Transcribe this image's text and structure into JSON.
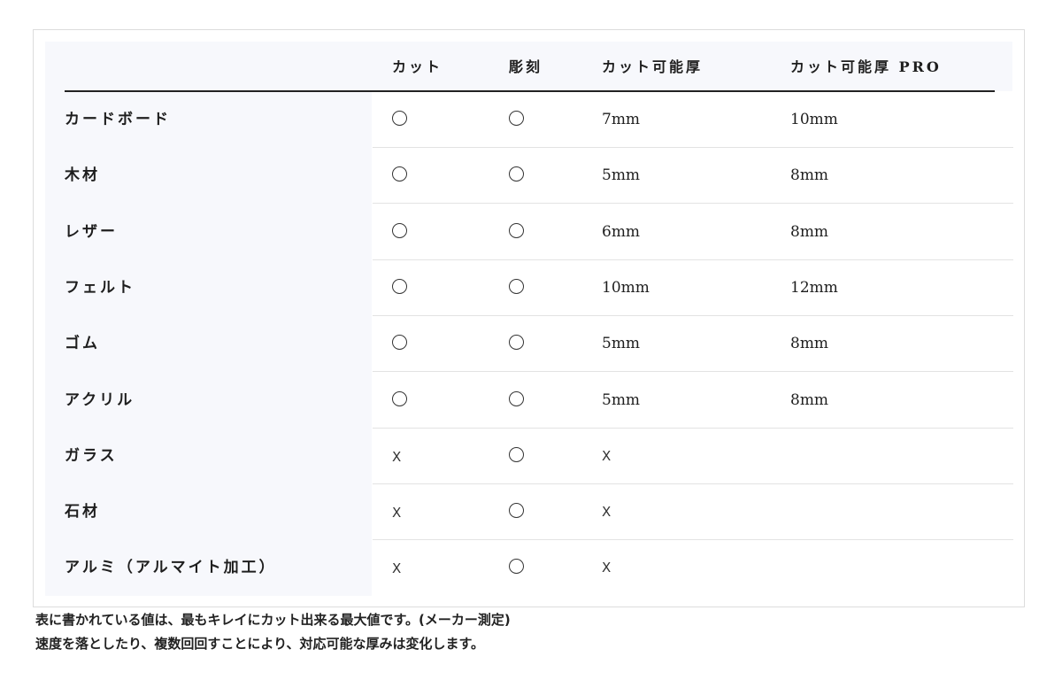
{
  "table": {
    "headers": {
      "material": "",
      "cut": "カット",
      "engrave": "彫刻",
      "thickness": "カット可能厚",
      "thickness_pro": "カット可能厚 PRO"
    },
    "rows": [
      {
        "material": "カードボード",
        "cut": "circle",
        "engrave": "circle",
        "thickness": "7mm",
        "thickness_pro": "10mm"
      },
      {
        "material": "木材",
        "cut": "circle",
        "engrave": "circle",
        "thickness": "5mm",
        "thickness_pro": "8mm"
      },
      {
        "material": "レザー",
        "cut": "circle",
        "engrave": "circle",
        "thickness": "6mm",
        "thickness_pro": "8mm"
      },
      {
        "material": "フェルト",
        "cut": "circle",
        "engrave": "circle",
        "thickness": "10mm",
        "thickness_pro": "12mm"
      },
      {
        "material": "ゴム",
        "cut": "circle",
        "engrave": "circle",
        "thickness": "5mm",
        "thickness_pro": "8mm"
      },
      {
        "material": "アクリル",
        "cut": "circle",
        "engrave": "circle",
        "thickness": "5mm",
        "thickness_pro": "8mm"
      },
      {
        "material": "ガラス",
        "cut": "X",
        "engrave": "circle",
        "thickness": "X",
        "thickness_pro": ""
      },
      {
        "material": "石材",
        "cut": "X",
        "engrave": "circle",
        "thickness": "X",
        "thickness_pro": ""
      },
      {
        "material": "アルミ（アルマイト加工）",
        "cut": "X",
        "engrave": "circle",
        "thickness": "X",
        "thickness_pro": ""
      }
    ]
  },
  "notes": {
    "line1": "表に書かれている値は、最もキレイにカット出来る最大値です。(メーカー測定)",
    "line2": "速度を落としたり、複数回回すことにより、対応可能な厚みは変化します。"
  }
}
